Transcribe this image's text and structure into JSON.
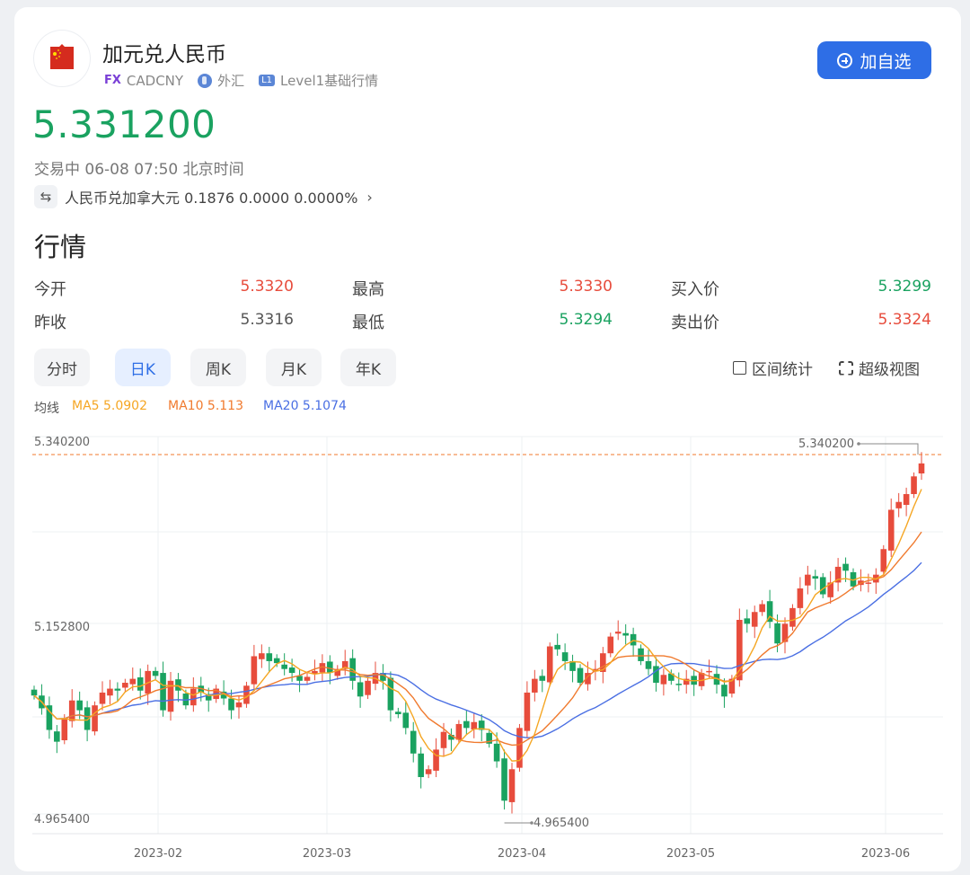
{
  "header": {
    "title": "加元兑人民币",
    "fx_badge": "FX",
    "symbol": "CADCNY",
    "market": "外汇",
    "level_badge": "L1",
    "level_label": "Level1基础行情",
    "add_watchlist": "加自选"
  },
  "price": {
    "last": "5.331200",
    "status": "交易中 06-08 07:50 北京时间",
    "reverse_pair": "人民币兑加拿大元 0.1876 0.0000 0.0000%",
    "price_color": "#1aa260"
  },
  "quote": {
    "section_title": "行情",
    "items": [
      {
        "label": "今开",
        "value": "5.3320",
        "color": "red"
      },
      {
        "label": "最高",
        "value": "5.3330",
        "color": "red"
      },
      {
        "label": "买入价",
        "value": "5.3299",
        "color": "green"
      },
      {
        "label": "昨收",
        "value": "5.3316",
        "color": "gray"
      },
      {
        "label": "最低",
        "value": "5.3294",
        "color": "green"
      },
      {
        "label": "卖出价",
        "value": "5.3324",
        "color": "red"
      }
    ]
  },
  "tabs": [
    "分时",
    "日K",
    "周K",
    "月K",
    "年K"
  ],
  "active_tab": "日K",
  "tools": {
    "range_stats": "区间统计",
    "super_view": "超级视图"
  },
  "ma": {
    "label": "均线",
    "ma5": "MA5 5.0902",
    "ma10": "MA10 5.113",
    "ma20": "MA20 5.1074",
    "ma5_color": "#f5a623",
    "ma10_color": "#f07a2e",
    "ma20_color": "#4a6fe3"
  },
  "colors": {
    "up": "#e74c3c",
    "down": "#1aa260",
    "accent": "#2e6ee6"
  },
  "chart_data": {
    "type": "candlestick",
    "x_labels": [
      "2023-02",
      "2023-03",
      "2023-04",
      "2023-05",
      "2023-06"
    ],
    "y_ticks": [
      "5.340200",
      "5.152800",
      "4.965400"
    ],
    "ylim": [
      4.9654,
      5.3402
    ],
    "max_label": "5.340200",
    "min_label": "4.965400",
    "close_series": [
      5.095,
      5.082,
      5.06,
      5.048,
      5.072,
      5.09,
      5.08,
      5.06,
      5.085,
      5.098,
      5.102,
      5.1,
      5.108,
      5.112,
      5.1,
      5.12,
      5.115,
      5.08,
      5.11,
      5.1,
      5.085,
      5.102,
      5.098,
      5.09,
      5.102,
      5.092,
      5.08,
      5.088,
      5.105,
      5.135,
      5.138,
      5.13,
      5.128,
      5.122,
      5.118,
      5.11,
      5.114,
      5.12,
      5.128,
      5.118,
      5.122,
      5.13,
      5.11,
      5.094,
      5.11,
      5.118,
      5.11,
      5.08,
      5.076,
      5.062,
      5.036,
      5.012,
      5.02,
      5.04,
      5.058,
      5.05,
      5.066,
      5.062,
      5.068,
      5.06,
      5.046,
      5.028,
      4.988,
      5.02,
      5.062,
      5.098,
      5.112,
      5.11,
      5.145,
      5.142,
      5.13,
      5.12,
      5.108,
      5.118,
      5.122,
      5.138,
      5.155,
      5.16,
      5.156,
      5.146,
      5.13,
      5.122,
      5.108,
      5.116,
      5.11,
      5.106,
      5.112,
      5.106,
      5.118,
      5.12,
      5.106,
      5.094,
      5.112,
      5.172,
      5.168,
      5.18,
      5.188,
      5.17,
      5.148,
      5.168,
      5.184,
      5.204,
      5.218,
      5.214,
      5.198,
      5.21,
      5.226,
      5.222,
      5.206,
      5.212,
      5.21,
      5.218,
      5.244,
      5.284,
      5.292,
      5.3,
      5.318,
      5.3312
    ]
  }
}
